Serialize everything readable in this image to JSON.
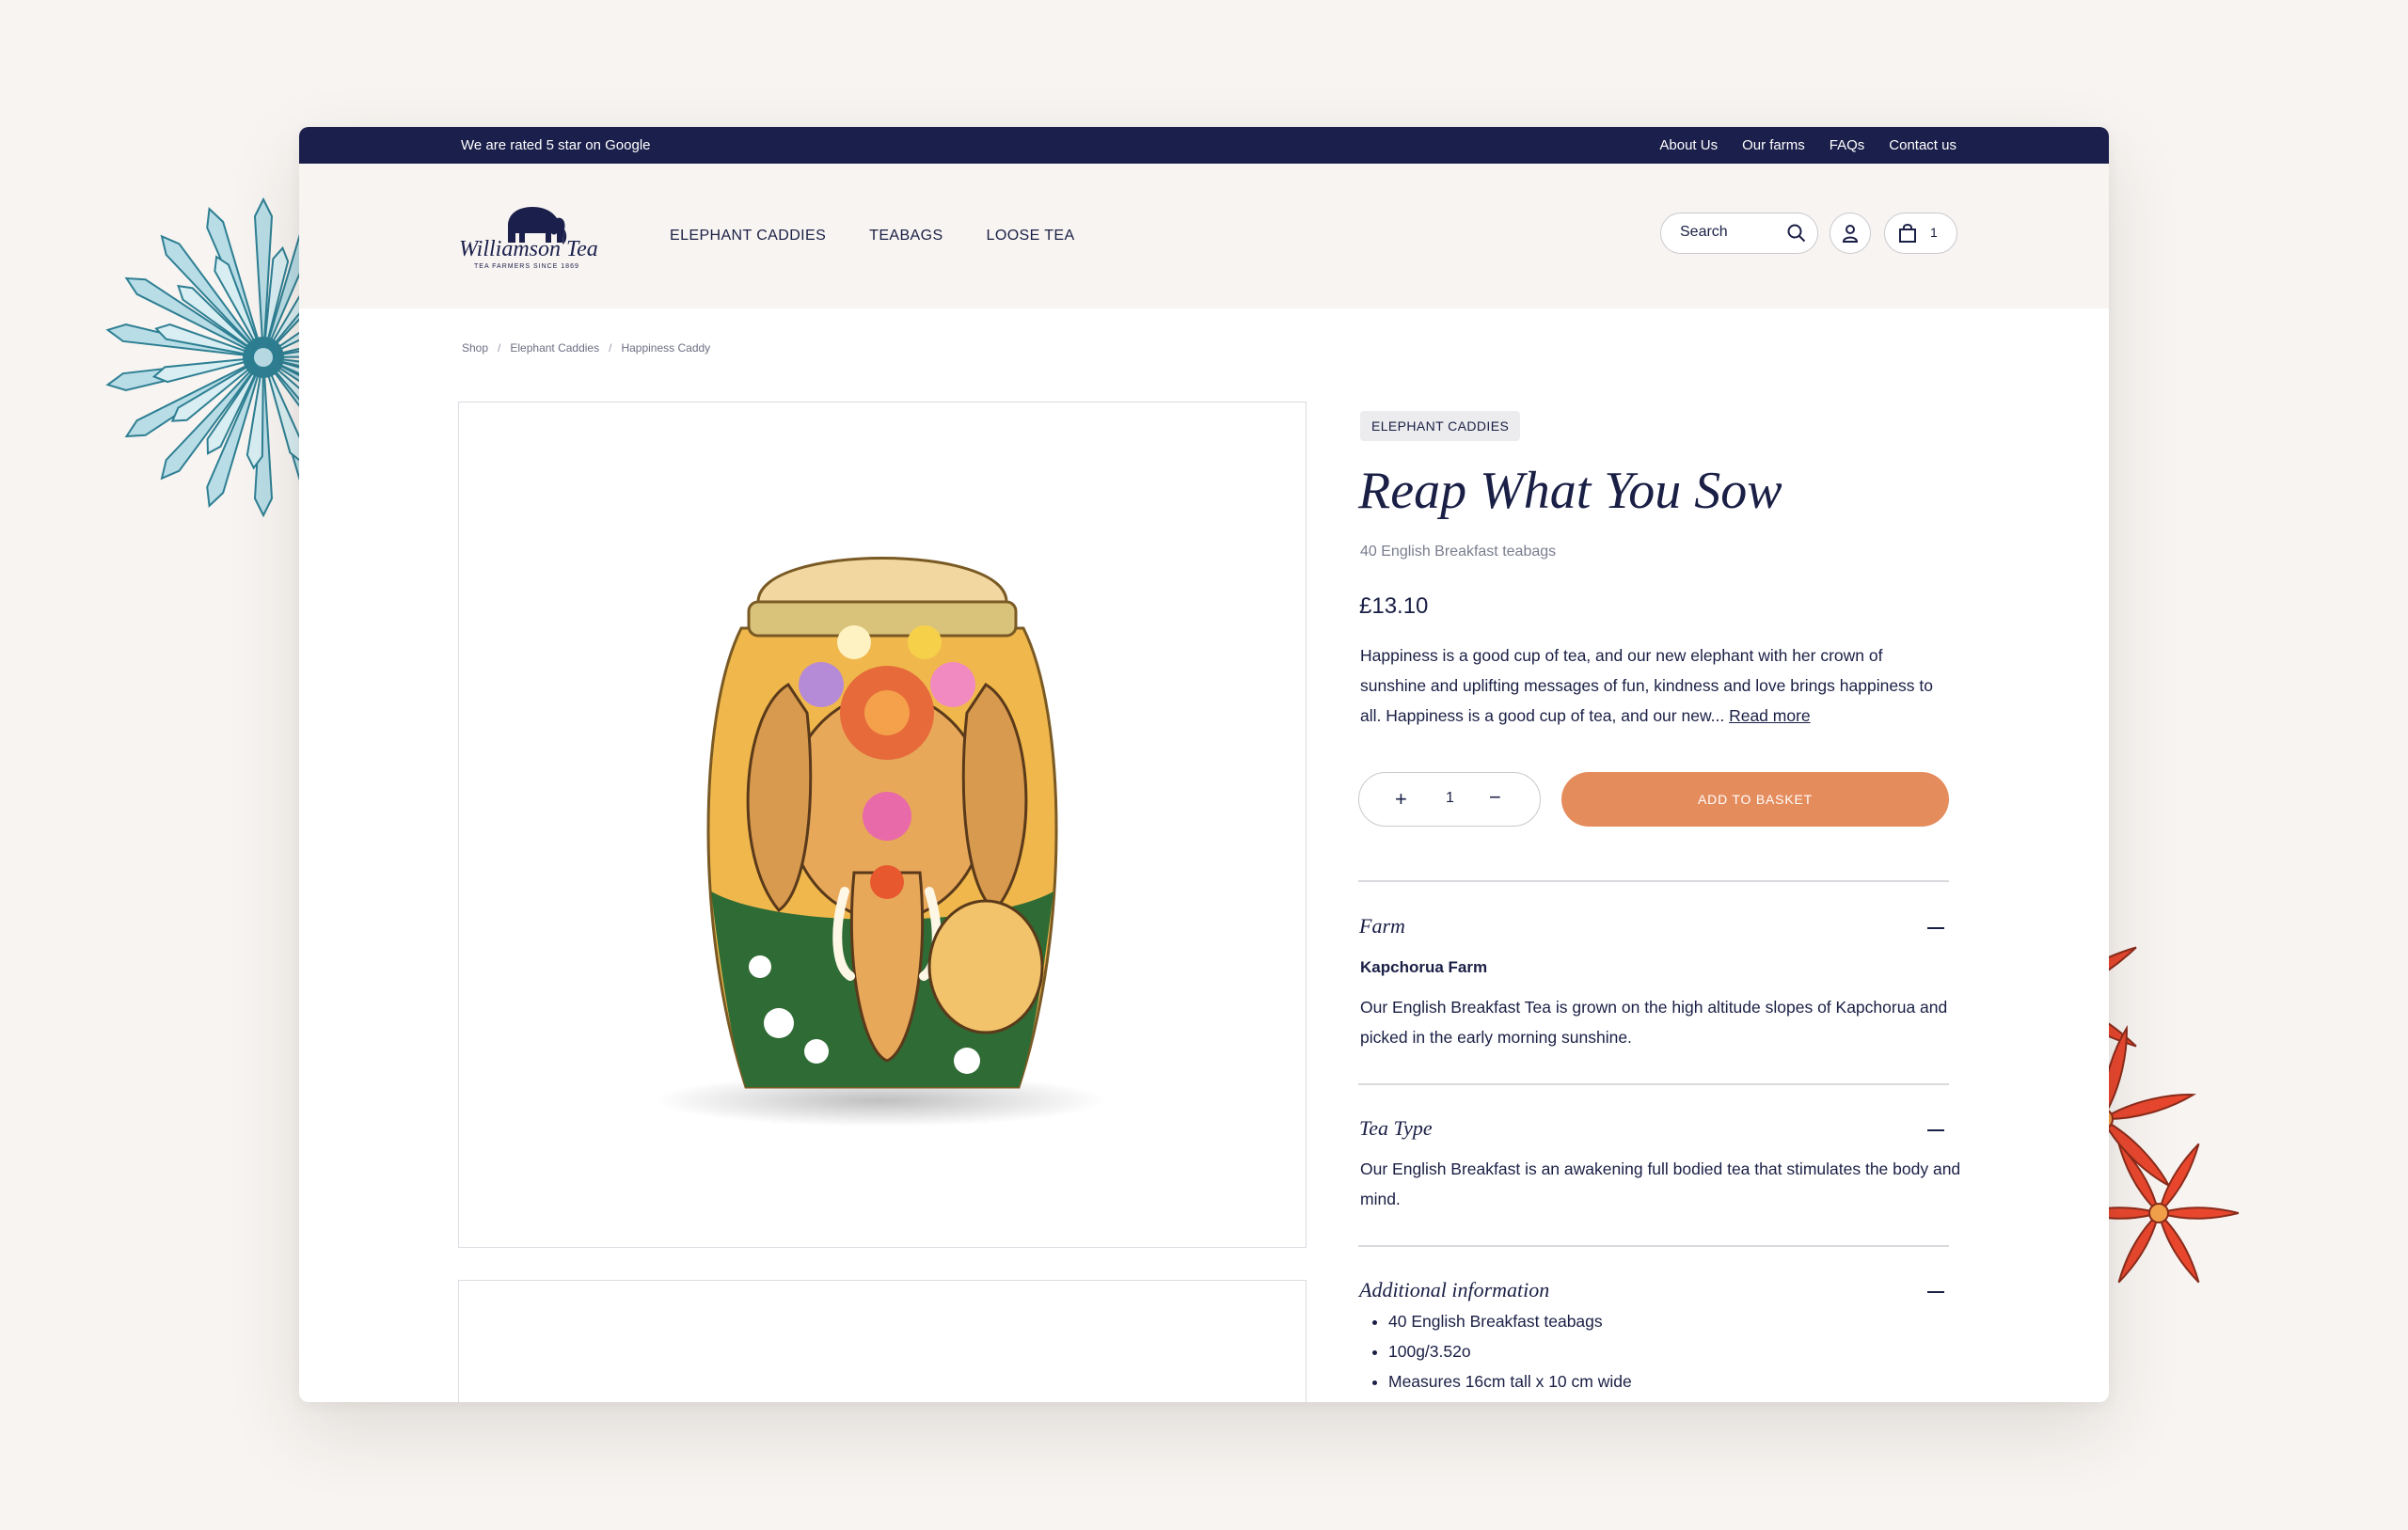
{
  "topbar": {
    "rating_text": "We are rated 5 star on Google",
    "links": [
      "About Us",
      "Our farms",
      "FAQs",
      "Contact us"
    ]
  },
  "header": {
    "logo_text": "Williamson Tea",
    "logo_tagline": "TEA FARMERS SINCE 1869",
    "nav": [
      "ELEPHANT CADDIES",
      "TEABAGS",
      "LOOSE TEA"
    ],
    "search_placeholder": "Search",
    "basket_count": "1"
  },
  "breadcrumb": [
    "Shop",
    "Elephant Caddies",
    "Happiness Caddy"
  ],
  "product": {
    "category_tag": "ELEPHANT CADDIES",
    "title": "Reap What You Sow",
    "subtitle": "40 English Breakfast teabags",
    "price": "£13.10",
    "description": "Happiness is a good cup of tea, and our new elephant with her crown of sunshine and uplifting messages of fun, kindness and love brings happiness to all. Happiness is a good cup of tea, and our new...",
    "read_more": "Read more",
    "quantity": "1",
    "add_to_basket": "ADD TO BASKET"
  },
  "accordion": {
    "farm": {
      "title": "Farm",
      "subtitle": "Kapchorua Farm",
      "text": "Our English Breakfast Tea is grown on the high altitude slopes of Kapchorua and picked in the early morning sunshine."
    },
    "tea_type": {
      "title": "Tea Type",
      "text": "Our English Breakfast is an awakening full bodied tea that stimulates the body and mind."
    },
    "additional": {
      "title": "Additional information",
      "items": [
        "40 English Breakfast teabags",
        "100g/3.52o",
        "Measures 16cm tall x 10 cm wide"
      ]
    }
  },
  "colors": {
    "navy": "#1b1f4b",
    "accent": "#e58c5d",
    "background": "#f7f4f1",
    "teal_flower": "#2e7f93",
    "red_flower": "#e8472e"
  }
}
